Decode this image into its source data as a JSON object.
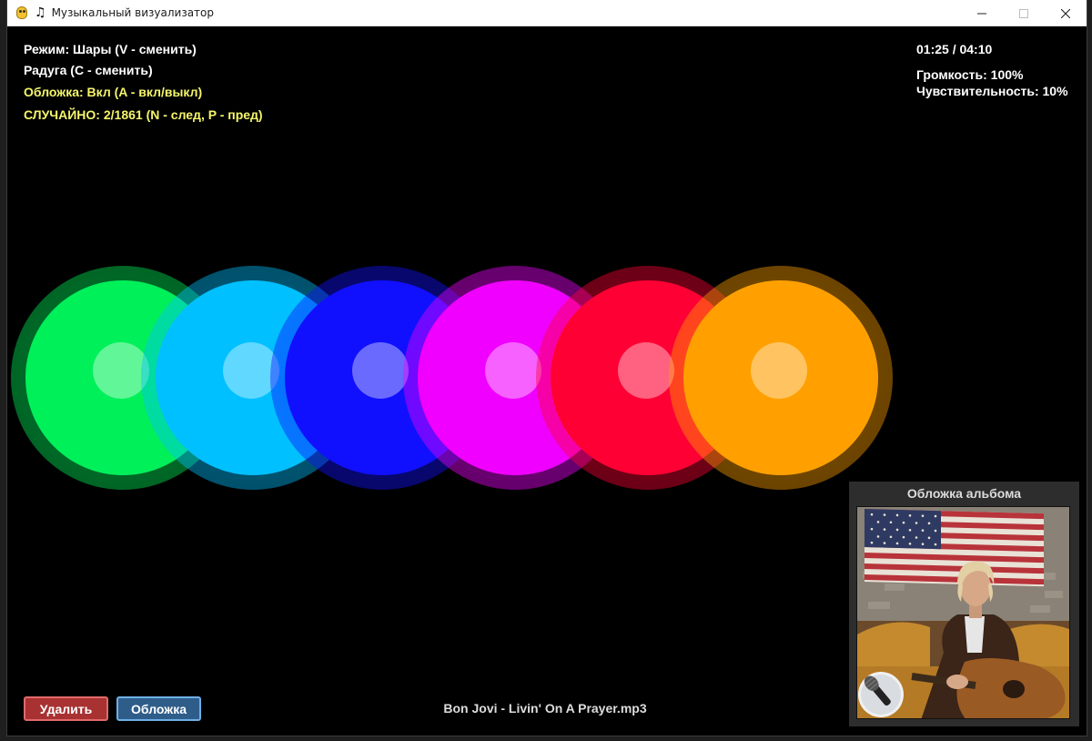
{
  "window": {
    "title": "Музыкальный визуализатор",
    "app_icon": "python-icon",
    "note_icon": "♫"
  },
  "hud": {
    "mode": "Режим: Шары (V - сменить)",
    "rainbow": "Радуга (C - сменить)",
    "cover": "Обложка: Вкл (A - вкл/выкл)",
    "shuffle": "СЛУЧАЙНО: 2/1861 (N - след, P - пред)",
    "time": "01:25 / 04:10",
    "volume": "Громкость: 100%",
    "sensitivity": "Чувствительность: 10%"
  },
  "orbs": [
    {
      "color": "#00f05a"
    },
    {
      "color": "#00c0ff"
    },
    {
      "color": "#1010ff"
    },
    {
      "color": "#f000ff"
    },
    {
      "color": "#ff0034"
    },
    {
      "color": "#ffa000"
    }
  ],
  "album": {
    "title": "Обложка альбома"
  },
  "buttons": {
    "delete": "Удалить",
    "cover": "Обложка"
  },
  "track": "Bon Jovi - Livin' On A Prayer.mp3"
}
